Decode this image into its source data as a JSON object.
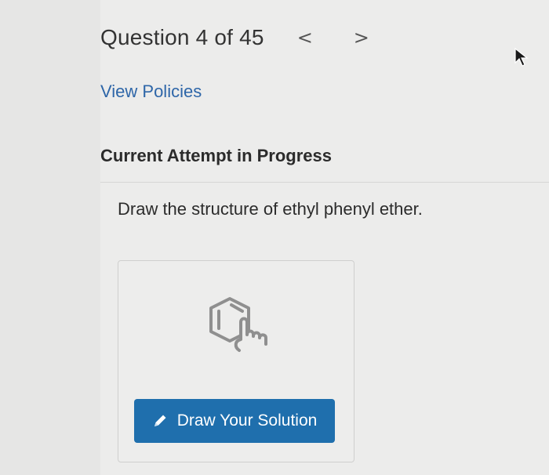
{
  "header": {
    "question_label": "Question 4 of 45",
    "prev_symbol": "<",
    "next_symbol": ">"
  },
  "links": {
    "view_policies": "View Policies"
  },
  "status": {
    "attempt_heading": "Current Attempt in Progress"
  },
  "question": {
    "prompt": "Draw the structure of ethyl phenyl ether."
  },
  "answer_area": {
    "draw_button_label": "Draw Your Solution",
    "hint_icon": "benzene-draw-hand-icon",
    "button_icon": "pencil-icon"
  },
  "colors": {
    "link": "#2e66a8",
    "primary_button": "#1f6fad"
  }
}
